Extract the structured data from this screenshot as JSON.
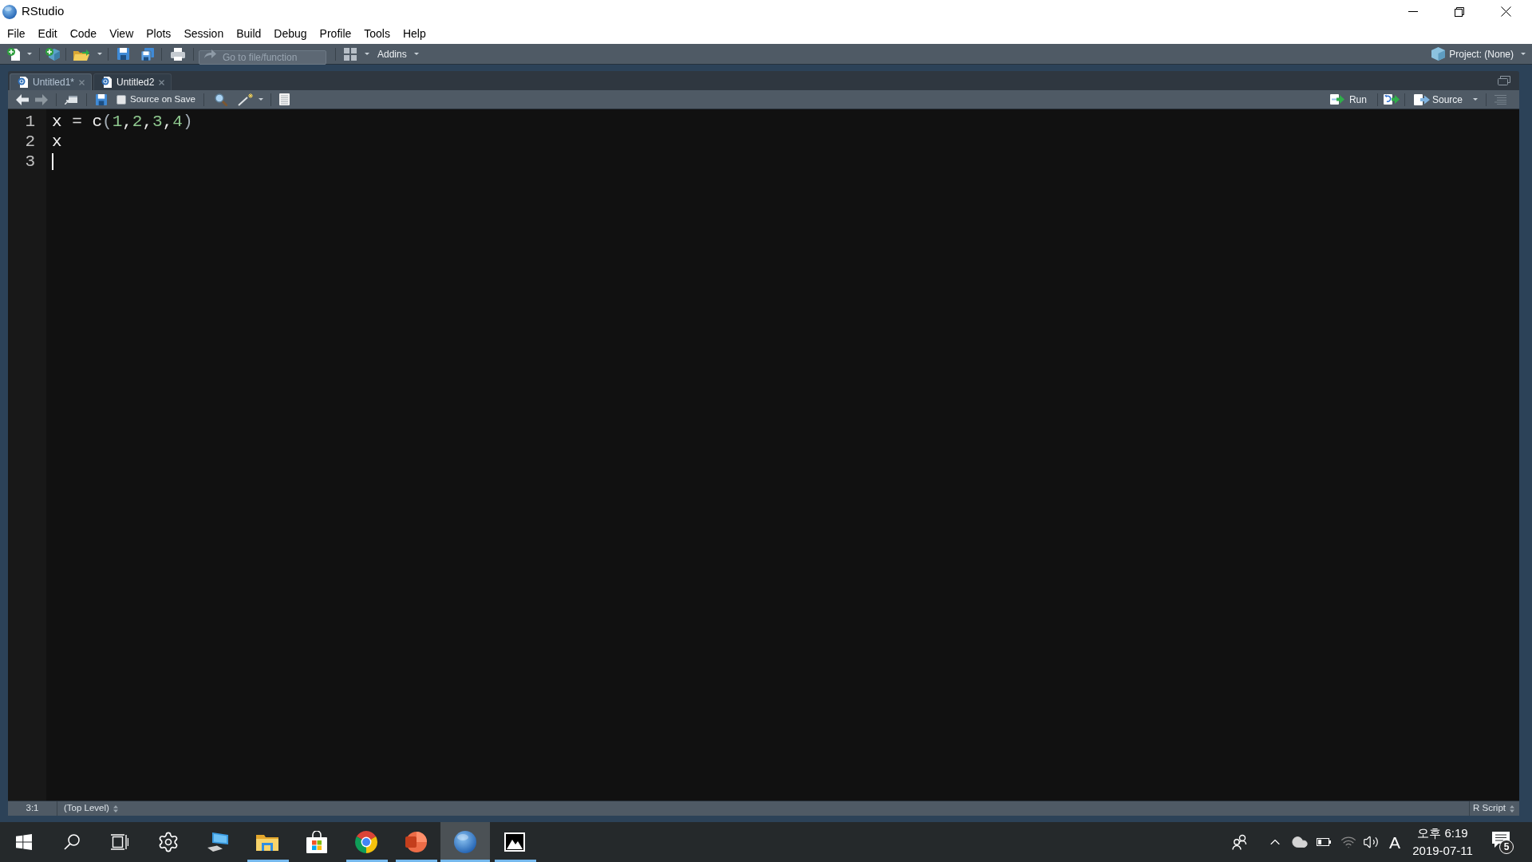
{
  "window": {
    "title": "RStudio"
  },
  "menu": [
    "File",
    "Edit",
    "Code",
    "View",
    "Plots",
    "Session",
    "Build",
    "Debug",
    "Profile",
    "Tools",
    "Help"
  ],
  "toolbar": {
    "goto": {
      "placeholder": "Go to file/function"
    },
    "addins": "Addins",
    "project": "Project: (None)"
  },
  "editor": {
    "tabs": [
      {
        "label": "Untitled1*",
        "selected": true
      },
      {
        "label": "Untitled2",
        "selected": false
      }
    ],
    "toolbar": {
      "back_disabled": false,
      "forward_disabled": true,
      "source_on_save": {
        "label": "Source on Save",
        "checked": false
      },
      "run": "Run",
      "source": "Source"
    },
    "lines": [
      {
        "number": "1",
        "cursor": false,
        "tokens": [
          {
            "text": "x",
            "kind": "identifier"
          },
          {
            "text": " = ",
            "kind": "operator"
          },
          {
            "text": "c",
            "kind": "identifier"
          },
          {
            "text": "(",
            "kind": "paren"
          },
          {
            "text": "1",
            "kind": "number"
          },
          {
            "text": ",",
            "kind": "comma"
          },
          {
            "text": "2",
            "kind": "number"
          },
          {
            "text": ",",
            "kind": "comma"
          },
          {
            "text": "3",
            "kind": "number"
          },
          {
            "text": ",",
            "kind": "comma"
          },
          {
            "text": "4",
            "kind": "number"
          },
          {
            "text": ")",
            "kind": "paren"
          }
        ]
      },
      {
        "number": "2",
        "cursor": false,
        "tokens": [
          {
            "text": "x",
            "kind": "identifier"
          }
        ]
      },
      {
        "number": "3",
        "cursor": true
      }
    ],
    "status": {
      "position": "3:1",
      "scope": "(Top Level)",
      "file_type": "R Script"
    }
  },
  "taskbar": {
    "apps": [
      {
        "kind": "settings",
        "running": false,
        "selected": false
      },
      {
        "kind": "computer",
        "running": false,
        "selected": false
      },
      {
        "kind": "folder",
        "running": true,
        "selected": false
      },
      {
        "kind": "store",
        "running": false,
        "selected": false
      },
      {
        "kind": "browser",
        "running": true,
        "selected": false
      },
      {
        "kind": "presentation",
        "running": true,
        "selected": false
      },
      {
        "kind": "rstudio",
        "running": true,
        "selected": true
      },
      {
        "kind": "photos",
        "running": true,
        "selected": false
      }
    ],
    "input_indicator": "A",
    "time": "오후 6:19",
    "date": "2019-07-11",
    "notification_count": "5"
  }
}
